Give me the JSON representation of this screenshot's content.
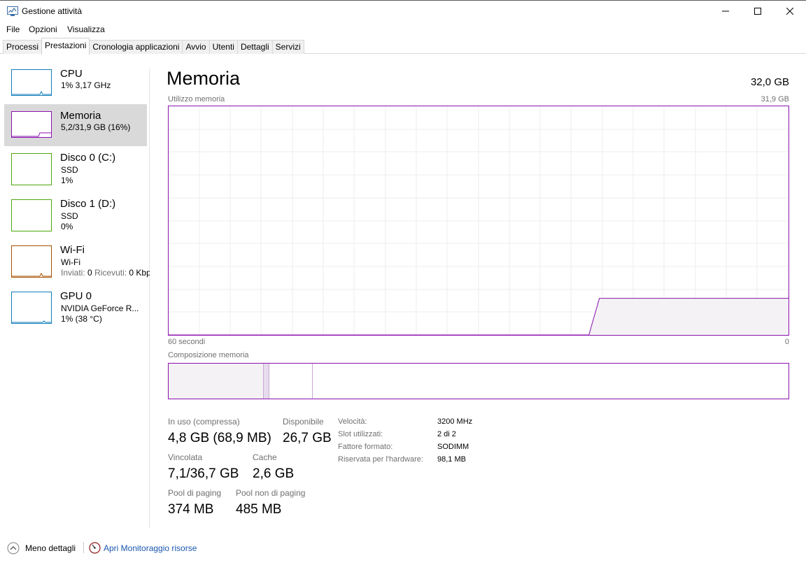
{
  "window": {
    "title": "Gestione attività"
  },
  "menu": [
    "File",
    "Opzioni",
    "Visualizza"
  ],
  "tabs": [
    "Processi",
    "Prestazioni",
    "Cronologia applicazioni",
    "Avvio",
    "Utenti",
    "Dettagli",
    "Servizi"
  ],
  "active_tab": "Prestazioni",
  "sidebar": {
    "items": [
      {
        "title": "CPU",
        "line1": "1% 3,17 GHz",
        "line2": "",
        "color": "#117dbb"
      },
      {
        "title": "Memoria",
        "line1": "5,2/31,9 GB (16%)",
        "line2": "",
        "color": "#8b12ae",
        "selected": true
      },
      {
        "title": "Disco 0 (C:)",
        "line1": "SSD",
        "line2": "1%",
        "color": "#4da60c"
      },
      {
        "title": "Disco 1 (D:)",
        "line1": "SSD",
        "line2": "0%",
        "color": "#4da60c"
      },
      {
        "title": "Wi-Fi",
        "line1": "Wi-Fi",
        "line2_label_sent": "Inviati:",
        "line2_sent": "0",
        "line2_label_recv": "Ricevuti:",
        "line2_recv": "0 Kbp",
        "color": "#a74f01"
      },
      {
        "title": "GPU 0",
        "line1": "NVIDIA GeForce R...",
        "line2": "1% (38 °C)",
        "color": "#117dbb"
      }
    ]
  },
  "main": {
    "heading": "Memoria",
    "total": "32,0 GB",
    "graph_label": "Utilizzo memoria",
    "graph_max": "31,9 GB",
    "axis_left": "60 secondi",
    "axis_right": "0",
    "composition_label": "Composizione memoria",
    "accent": "#8b12ae",
    "usage_series_percent": [
      0,
      0,
      0,
      0,
      0,
      0,
      0,
      0,
      0,
      0,
      0,
      0,
      0,
      0,
      0,
      0,
      0,
      0,
      0,
      0,
      0,
      0,
      0,
      0,
      0,
      0,
      0,
      0,
      0,
      0,
      0,
      0,
      0,
      0,
      0,
      0,
      0,
      0,
      0,
      0,
      0,
      16,
      16,
      16,
      16,
      16,
      16,
      16,
      16,
      16,
      16,
      16,
      16,
      16,
      16,
      16,
      16,
      16,
      16,
      16
    ],
    "stats": {
      "in_use_label": "In uso (compressa)",
      "in_use_value": "4,8 GB (68,9 MB)",
      "available_label": "Disponibile",
      "available_value": "26,7 GB",
      "committed_label": "Vincolata",
      "committed_value": "7,1/36,7 GB",
      "cached_label": "Cache",
      "cached_value": "2,6 GB",
      "paged_label": "Pool di paging",
      "paged_value": "374 MB",
      "nonpaged_label": "Pool non di paging",
      "nonpaged_value": "485 MB"
    },
    "details": [
      {
        "label": "Velocità:",
        "value": "3200 MHz"
      },
      {
        "label": "Slot utilizzati:",
        "value": "2 di 2"
      },
      {
        "label": "Fattore formato:",
        "value": "SODIMM"
      },
      {
        "label": "Riservata per l'hardware:",
        "value": "98,1 MB"
      }
    ]
  },
  "footer": {
    "less_details": "Meno dettagli",
    "resource_monitor": "Apri Monitoraggio risorse"
  }
}
